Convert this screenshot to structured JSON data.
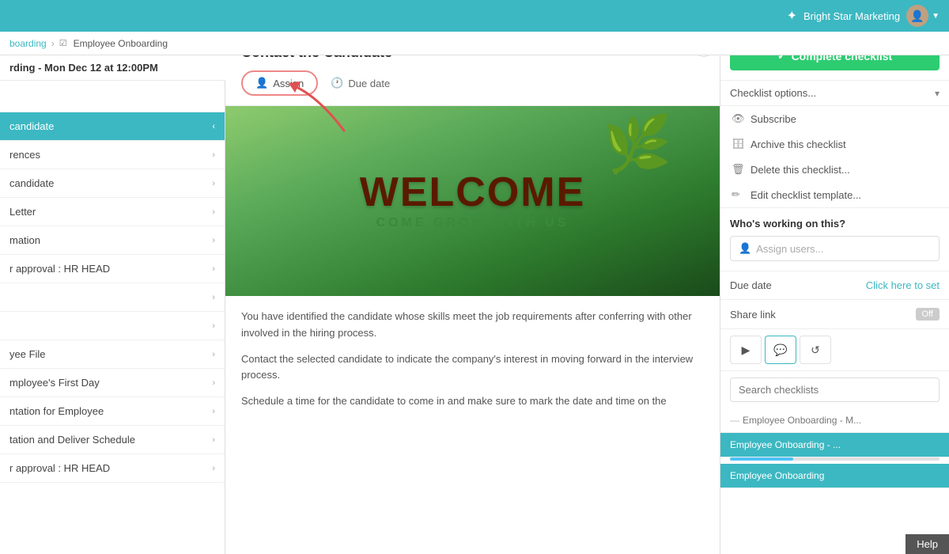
{
  "topnav": {
    "brand": "Bright Star Marketing",
    "chevron": "▼"
  },
  "breadcrumb": {
    "items": [
      "boarding",
      "Employee Onboarding"
    ]
  },
  "subtitle": "rding - Mon Dec 12 at 12:00PM",
  "sidebar": {
    "items": [
      {
        "label": "candidate",
        "active": true
      },
      {
        "label": "rences"
      },
      {
        "label": "candidate"
      },
      {
        "label": "Letter"
      },
      {
        "label": "mation"
      },
      {
        "label": "r approval : HR HEAD"
      },
      {
        "label": ""
      },
      {
        "label": ""
      },
      {
        "label": "yee File"
      },
      {
        "label": "mployee's First Day"
      },
      {
        "label": "ntation for Employee"
      },
      {
        "label": "tation and Deliver Schedule"
      },
      {
        "label": "r approval : HR HEAD"
      }
    ]
  },
  "content": {
    "title": "Contact the Candidate",
    "assign_label": "Assign",
    "due_date_label": "Due date",
    "body_paragraphs": [
      "You have identified the candidate whose skills meet the job requirements after conferring with other involved in the hiring process.",
      "Contact the selected candidate to indicate the company's interest in moving forward in the interview process.",
      "Schedule a time for the candidate to come in and make sure to mark the date and time on the"
    ]
  },
  "right_panel": {
    "complete_btn": "Complete checklist",
    "checklist_options_label": "Checklist options...",
    "dropdown_items": [
      {
        "icon": "👁",
        "label": "Subscribe"
      },
      {
        "icon": "🗄",
        "label": "Archive this checklist"
      },
      {
        "icon": "🗑",
        "label": "Delete this checklist..."
      },
      {
        "icon": "✏",
        "label": "Edit checklist template..."
      }
    ],
    "whos_working_title": "Who's working on this?",
    "assign_users_placeholder": "Assign users...",
    "due_date_label": "Due date",
    "due_date_action": "Click here to set",
    "share_link_label": "Share link",
    "share_link_toggle": "Off",
    "search_placeholder": "Search checklists",
    "checklist_items": [
      {
        "label": "Employee Onboarding - M...",
        "active": false
      },
      {
        "label": "Employee Onboarding - ...",
        "active": true
      },
      {
        "label": "Employee Onboarding",
        "active": true
      }
    ],
    "help_label": "Help"
  }
}
